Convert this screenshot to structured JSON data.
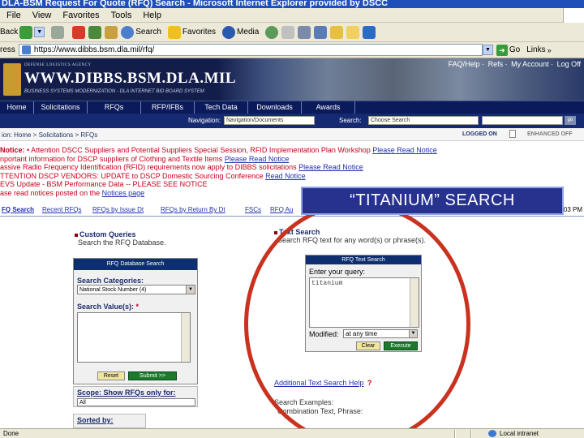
{
  "window": {
    "title": "DLA-BSM Request For Quote (RFQ) Search - Microsoft Internet Explorer provided by DSCC"
  },
  "menubar": {
    "items": [
      "File",
      "View",
      "Favorites",
      "Tools",
      "Help"
    ]
  },
  "toolbar": {
    "back": "Back",
    "search": "Search",
    "favorites": "Favorites",
    "media": "Media"
  },
  "addressbar": {
    "label": "ress",
    "url": "https://www.dibbs.bsm.dla.mil/rfq/",
    "go": "Go",
    "links": "Links"
  },
  "dibbs": {
    "agency": "DEFENSE LOGISTICS AGENCY",
    "title": "WWW.DIBBS.BSM.DLA.MIL",
    "subtitle": "BUSINESS SYSTEMS MODERNIZATION - DLA INTERNET BID BOARD SYSTEM",
    "toplinks": [
      "FAQ/Help",
      "Refs",
      "My Account",
      "Log Off"
    ]
  },
  "nav": {
    "items": [
      "Home",
      "Solicitations",
      "RFQs",
      "RFP/IFBs",
      "Tech Data",
      "Downloads",
      "Awards"
    ]
  },
  "subbar": {
    "navigation_label": "Navigation:",
    "navigation_value": "Navigation/Documents",
    "search_label": "Search:",
    "search_value": "Choose Search",
    "go": "go"
  },
  "location": {
    "path": "ion: Home > Solicitations > RFQs",
    "logged_on": "LOGGED ON",
    "enhanced": "ENHANCED OFF"
  },
  "notices": {
    "label": "Notice:",
    "lines": [
      {
        "red": "• Attention DSCC Suppliers and Potential Suppliers Special Session, RFID Implementation Plan Workshop",
        "link": "Please Read Notice",
        "plain": ""
      },
      {
        "red": "",
        "link": "Please Read Notice",
        "plain": "nportant information for DSCP suppliers of Clothing and Textile Items "
      },
      {
        "red": "",
        "link": "Please Read Notice",
        "plain": "assive Radio Frequency Identification (RFID) requirements now apply to DIBBS solicitations "
      },
      {
        "red": "TTENTION DSCP VENDORS: UPDATE to DSCP Domestic Sourcing Conference",
        "link": "Read Notice",
        "plain": ""
      },
      {
        "red": "EVS Update - BSM Performance Data -- PLEASE SEE NOTICE",
        "link": "",
        "plain": ""
      },
      {
        "red": "",
        "link": "Notices page",
        "plain": "ase read notices posted on the "
      }
    ]
  },
  "tabs": {
    "items": [
      "FQ Search",
      "Recent RFQs",
      "RFQs by Issue Dt",
      "RFQs by Return By Dt",
      "FSCs",
      "RFQ Au"
    ],
    "time": "03 PM"
  },
  "callout": {
    "text": "“TITANIUM” SEARCH"
  },
  "custom_queries": {
    "title": "Custom Queries",
    "desc": "Search the RFQ Database.",
    "panel_header": "RFQ Database Search",
    "categories_label": "Search Categories:",
    "categories_value": "National Stock Number (4)",
    "values_label": "Search Value(s):",
    "required": "*",
    "reset": "Reset",
    "submit": "Submit >>",
    "scope_label": "Scope: Show RFQs only for:",
    "scope_value": "All",
    "sorted_label": "Sorted by:"
  },
  "text_search": {
    "title": "Text Search",
    "desc": "Search RFQ text for any word(s) or phrase(s).",
    "panel_header": "RFQ Text Search",
    "query_label": "Enter your query:",
    "query_value": "titanium",
    "modified_label": "Modified:",
    "modified_value": "at any time",
    "clear": "Clear",
    "execute": "Execute",
    "help": "Additional Text Search Help",
    "examples_label": "Search Examples:",
    "examples_text": "Combination Text, Phrase:"
  },
  "statusbar": {
    "done": "Done",
    "zone": "Local intranet"
  },
  "colors": {
    "dibbs_header": "#131d4a",
    "nav": "#0a1a5a",
    "callout": "#27328f",
    "circle": "#c8321e",
    "notice_red": "#c4001a"
  }
}
